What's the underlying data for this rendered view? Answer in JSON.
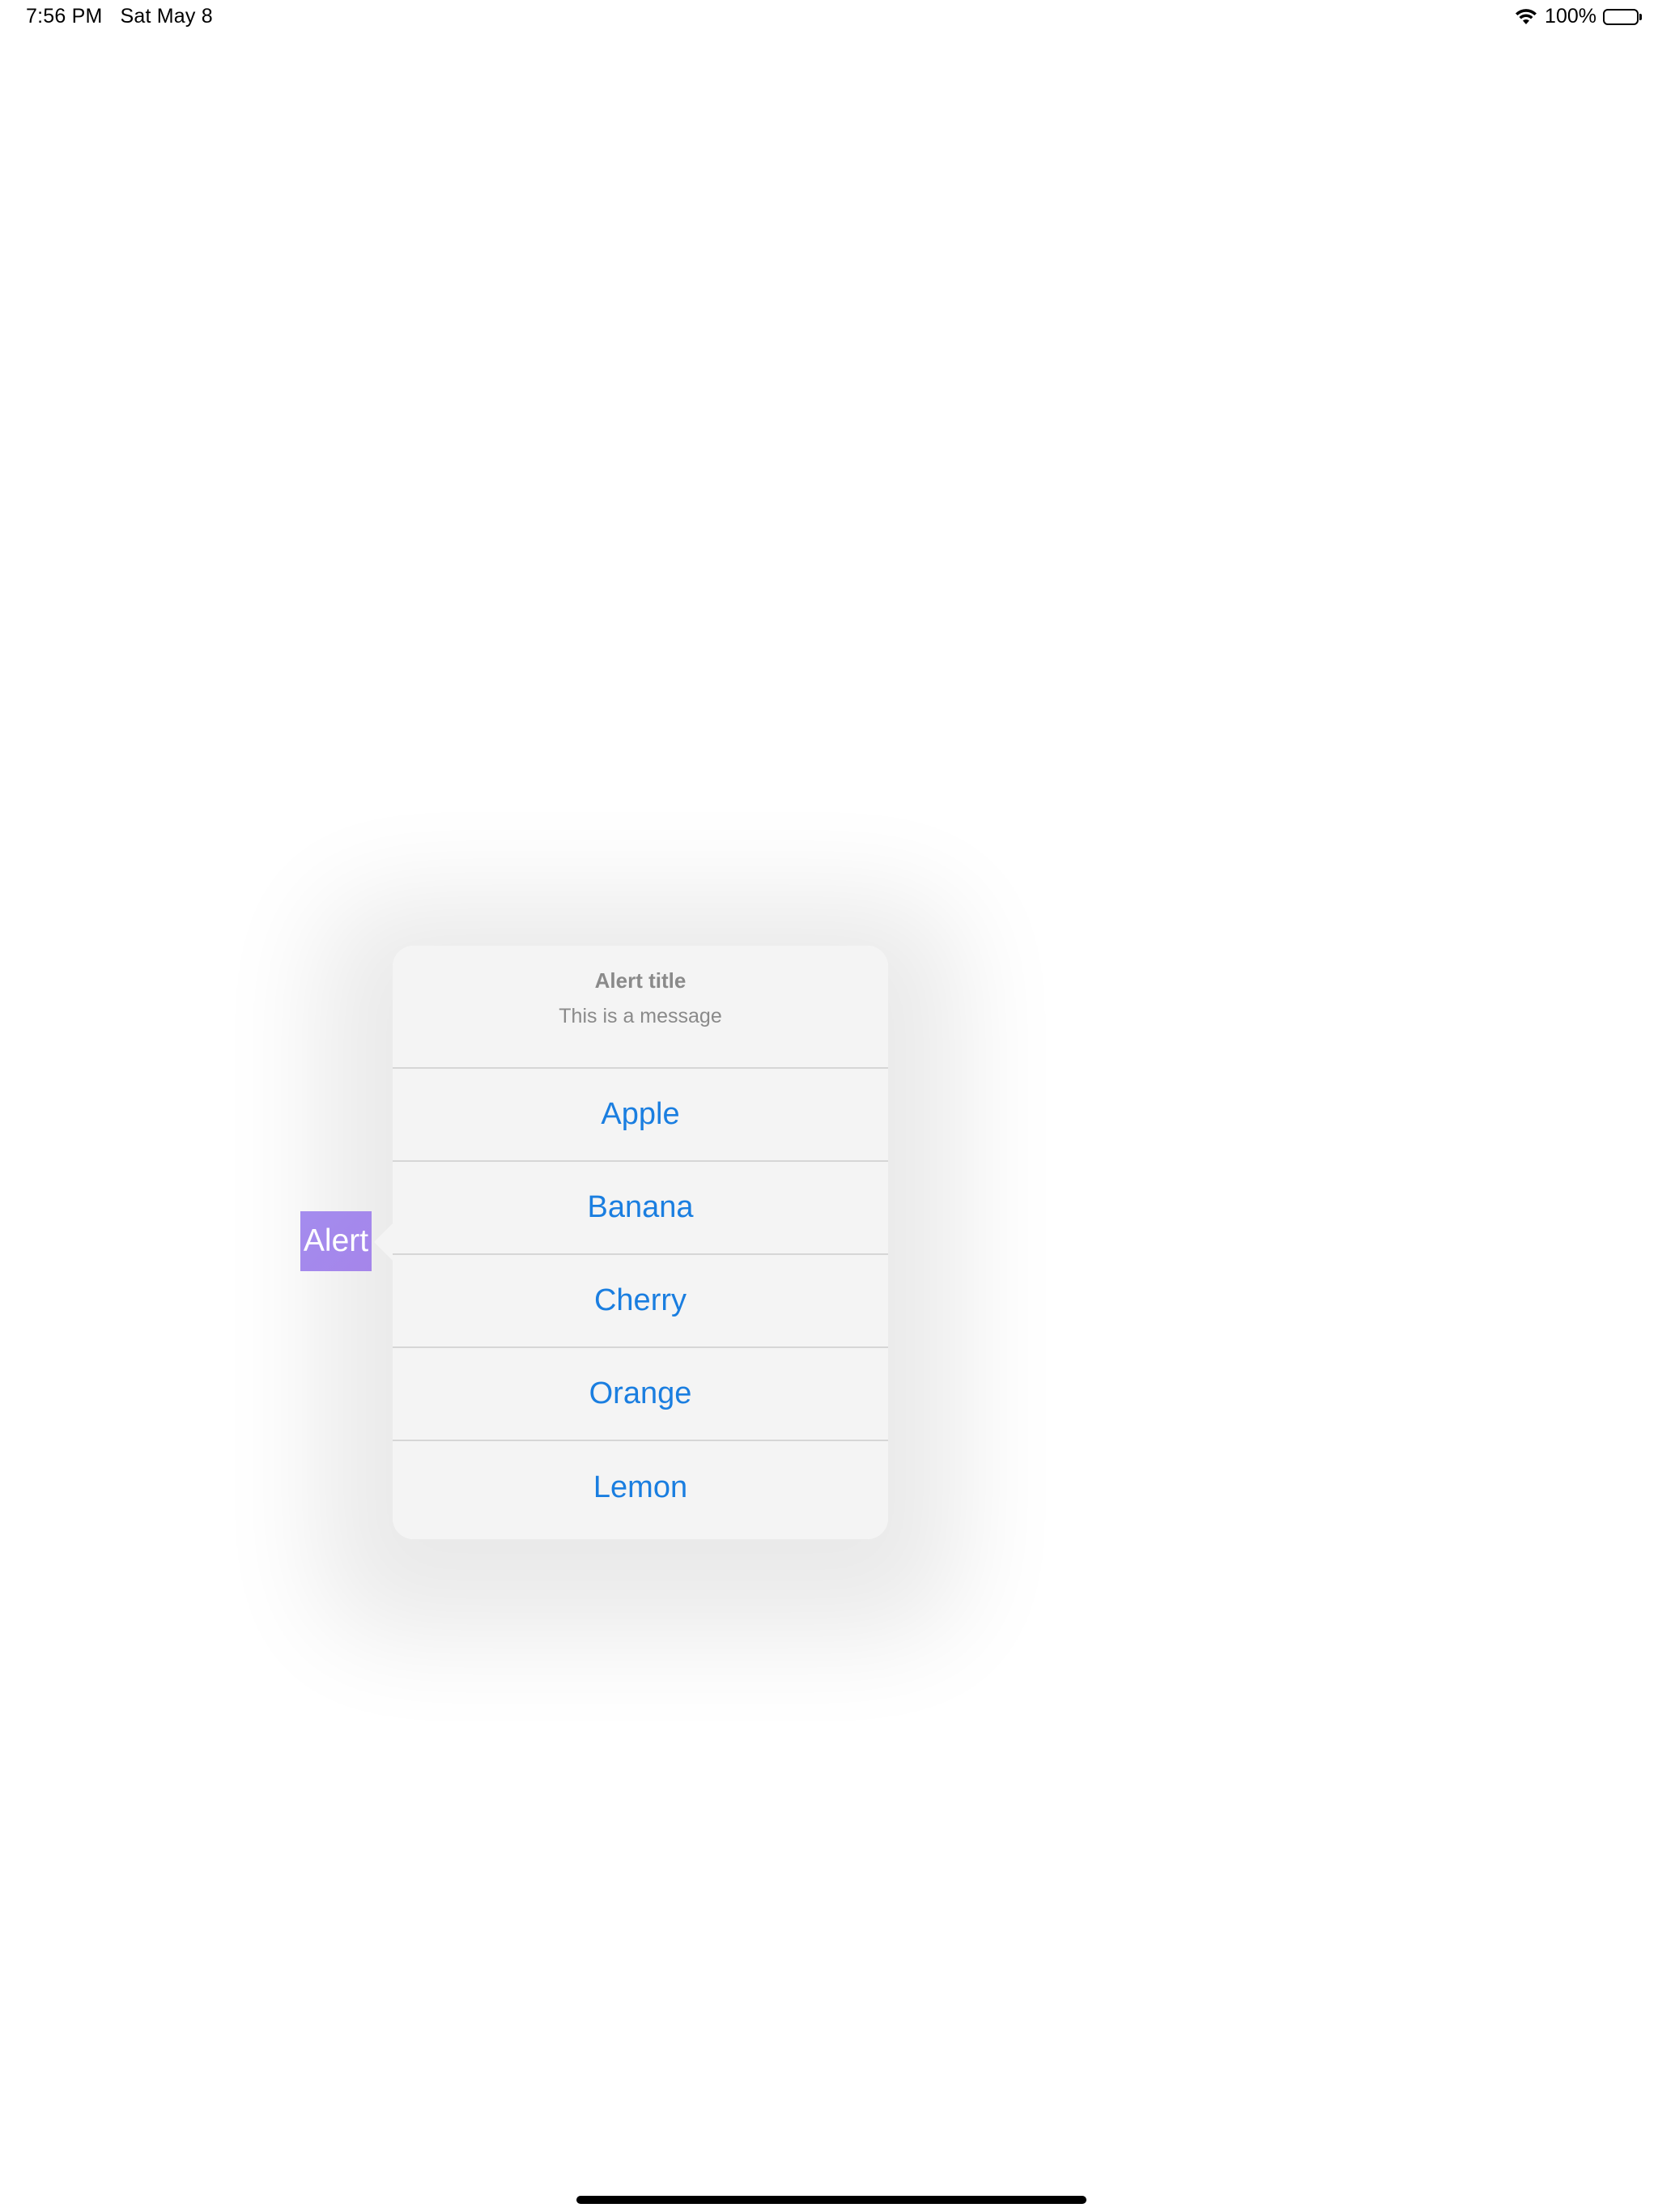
{
  "status_bar": {
    "time": "7:56 PM",
    "date": "Sat May 8",
    "battery_percent": "100%",
    "battery_level": 1.0
  },
  "alert_button": {
    "label": "Alert",
    "color": "#a48cee"
  },
  "popover": {
    "title": "Alert title",
    "message": "This is a message",
    "actions": [
      {
        "label": "Apple"
      },
      {
        "label": "Banana"
      },
      {
        "label": "Cherry"
      },
      {
        "label": "Orange"
      },
      {
        "label": "Lemon"
      }
    ],
    "action_color": "#1a7ee0"
  }
}
